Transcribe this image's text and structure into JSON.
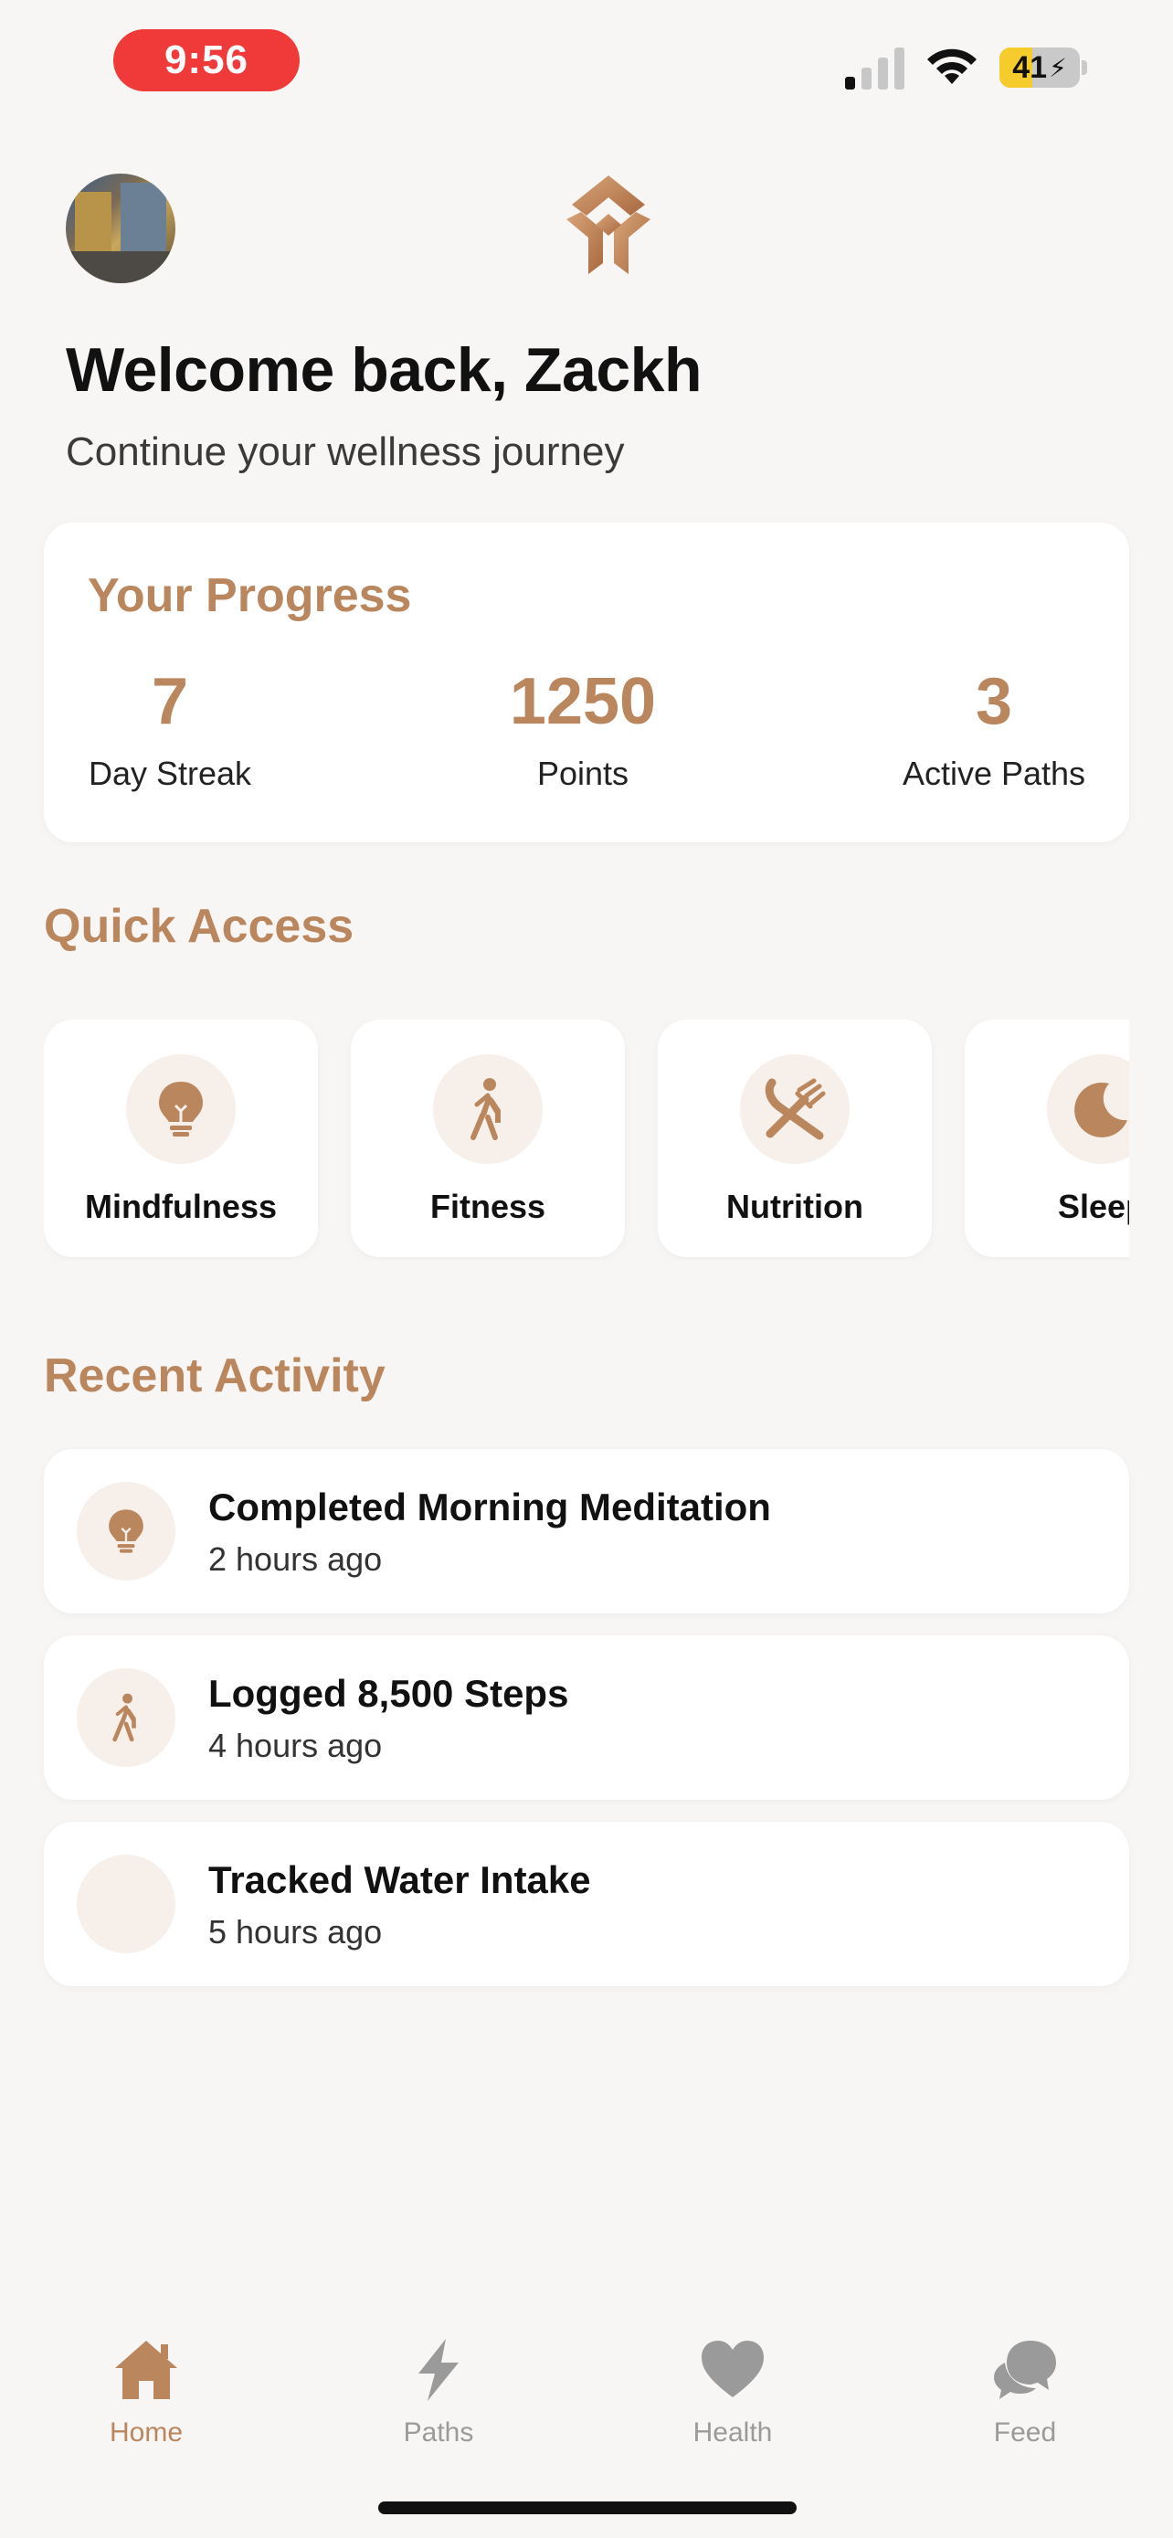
{
  "status_bar": {
    "time": "9:56",
    "battery_level": "41",
    "battery_fraction": 0.41
  },
  "header": {
    "welcome": "Welcome back, Zackh",
    "subtitle": "Continue your wellness journey"
  },
  "progress": {
    "title": "Your Progress",
    "stats": [
      {
        "value": "7",
        "label": "Day Streak"
      },
      {
        "value": "1250",
        "label": "Points"
      },
      {
        "value": "3",
        "label": "Active Paths"
      }
    ]
  },
  "quick_access": {
    "title": "Quick Access",
    "items": [
      {
        "label": "Mindfulness",
        "icon": "lightbulb-icon"
      },
      {
        "label": "Fitness",
        "icon": "walking-icon"
      },
      {
        "label": "Nutrition",
        "icon": "fork-knife-icon"
      },
      {
        "label": "Sleep",
        "icon": "moon-icon"
      }
    ]
  },
  "recent_activity": {
    "title": "Recent Activity",
    "items": [
      {
        "title": "Completed Morning Meditation",
        "time": "2 hours ago",
        "icon": "lightbulb-icon"
      },
      {
        "title": "Logged 8,500 Steps",
        "time": "4 hours ago",
        "icon": "walking-icon"
      },
      {
        "title": "Tracked Water Intake",
        "time": "5 hours ago",
        "icon": "none"
      }
    ]
  },
  "tab_bar": {
    "tabs": [
      {
        "label": "Home",
        "icon": "home-icon",
        "active": true
      },
      {
        "label": "Paths",
        "icon": "lightning-icon",
        "active": false
      },
      {
        "label": "Health",
        "icon": "heart-icon",
        "active": false
      },
      {
        "label": "Feed",
        "icon": "chat-bubbles-icon",
        "active": false
      }
    ]
  },
  "colors": {
    "accent": "#b9865e",
    "background": "#f8f6f4",
    "icon_bg": "#f7efea",
    "tab_inactive": "#9a9a9a"
  }
}
